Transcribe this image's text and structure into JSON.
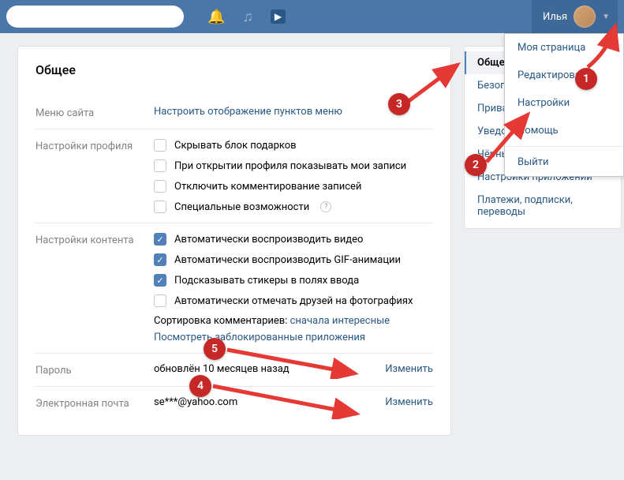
{
  "header": {
    "user_name": "Илья"
  },
  "page_title": "Общее",
  "rows": {
    "menu": {
      "label": "Меню сайта",
      "link": "Настроить отображение пунктов меню"
    },
    "profile": {
      "label": "Настройки профиля",
      "opts": [
        {
          "checked": false,
          "text": "Скрывать блок подарков"
        },
        {
          "checked": false,
          "text": "При открытии профиля показывать мои записи"
        },
        {
          "checked": false,
          "text": "Отключить комментирование записей"
        },
        {
          "checked": false,
          "text": "Специальные возможности",
          "help": true
        }
      ]
    },
    "content": {
      "label": "Настройки контента",
      "opts": [
        {
          "checked": true,
          "text": "Автоматически воспроизводить видео"
        },
        {
          "checked": true,
          "text": "Автоматически воспроизводить GIF-анимации"
        },
        {
          "checked": true,
          "text": "Подсказывать стикеры в полях ввода"
        },
        {
          "checked": false,
          "text": "Автоматически отмечать друзей на фотографиях"
        }
      ],
      "sort_prefix": "Сортировка комментариев: ",
      "sort_link": "сначала интересные",
      "blocked_link": "Посмотреть заблокированные приложения"
    },
    "password": {
      "label": "Пароль",
      "value": "обновлён 10 месяцев назад",
      "change": "Изменить"
    },
    "email": {
      "label": "Электронная почта",
      "value": "se***@yahoo.com",
      "change": "Изменить"
    }
  },
  "side_tabs": [
    "Общее",
    "Безопасность",
    "Приватность",
    "Уведомления",
    "Чёрный список",
    "Настройки приложений",
    "Платежи, подписки, переводы"
  ],
  "dropdown": [
    "Моя страница",
    "Редактировать",
    "Настройки",
    "Помощь",
    "",
    "Выйти"
  ],
  "annotations": [
    "1",
    "2",
    "3",
    "4",
    "5"
  ]
}
